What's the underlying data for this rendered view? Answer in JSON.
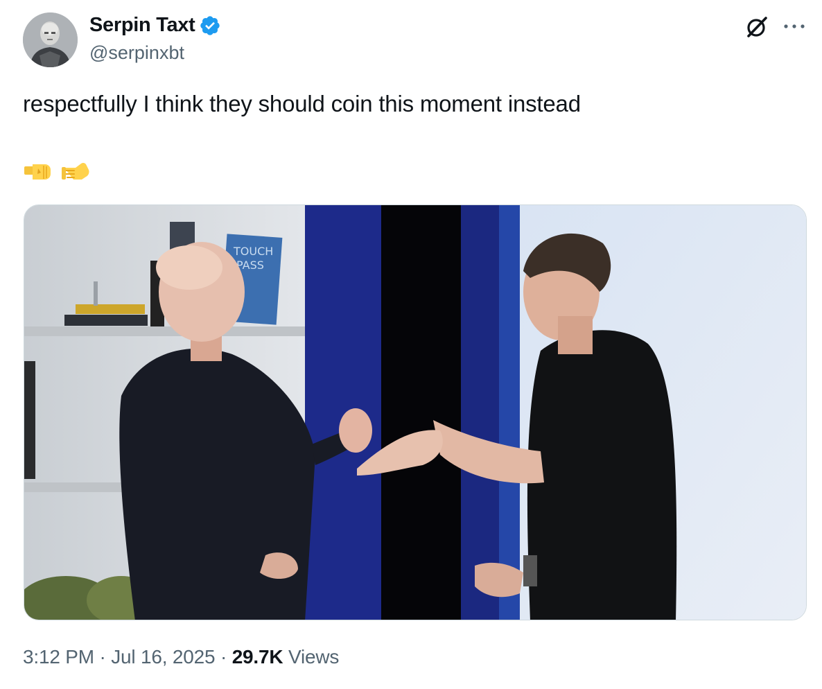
{
  "author": {
    "display_name": "Serpin Taxt",
    "handle": "@serpinxbt",
    "verified": true,
    "avatar_icon": "avatar-portrait"
  },
  "tweet": {
    "text": "respectfully I think they should coin this moment instead",
    "emojis": [
      "fist-bump-left-emoji",
      "handshake-right-emoji"
    ],
    "media_description_icon": "photo-two-men-handshake"
  },
  "header_icons": {
    "grok": "grok-icon",
    "more": "more-icon"
  },
  "meta": {
    "time": "3:12 PM",
    "separator": "·",
    "date": "Jul 16, 2025",
    "views_count": "29.7K",
    "views_label": "Views"
  },
  "colors": {
    "verified_blue": "#1d9bf0",
    "secondary_text": "#536471",
    "primary_text": "#0f1419",
    "border": "#cfd9de"
  }
}
